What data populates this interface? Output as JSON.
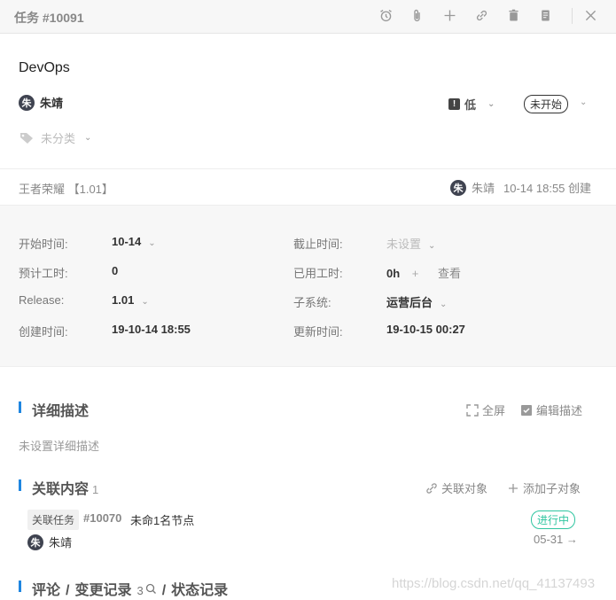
{
  "header": {
    "title": "任务 #10091",
    "icons": [
      "alarm-icon",
      "attachment-icon",
      "add-icon",
      "link-icon",
      "delete-icon",
      "copy-icon",
      "close-icon"
    ]
  },
  "task": {
    "name": "DevOps",
    "assignee": {
      "avatar": "朱",
      "name": "朱靖"
    },
    "priority": {
      "flag": "!",
      "label": "低"
    },
    "status": "未开始",
    "category": "未分类"
  },
  "meta": {
    "project": "王者荣耀 【1.01】",
    "creator_avatar": "朱",
    "creator_name": "朱靖",
    "created_text": "10-14 18:55 创建"
  },
  "props": {
    "start_label": "开始时间:",
    "start_value": "10-14",
    "due_label": "截止时间:",
    "due_value": "未设置",
    "estimate_label": "预计工时:",
    "estimate_value": "0",
    "spent_label": "已用工时:",
    "spent_value": "0h",
    "spent_add": "+",
    "spent_view": "查看",
    "release_label": "Release:",
    "release_value": "1.01",
    "subsystem_label": "子系统:",
    "subsystem_value": "运营后台",
    "created_label": "创建时间:",
    "created_value": "19-10-14 18:55",
    "updated_label": "更新时间:",
    "updated_value": "19-10-15 00:27"
  },
  "description": {
    "title": "详细描述",
    "fullscreen": "全屏",
    "edit": "编辑描述",
    "empty": "未设置详细描述"
  },
  "related": {
    "title": "关联内容",
    "count": "1",
    "link_action": "关联对象",
    "add_child": "添加子对象",
    "item": {
      "tag": "关联任务",
      "id": "#10070",
      "name": "未命1名节点",
      "avatar": "朱",
      "assignee": "朱靖",
      "status": "进行中",
      "date": "05-31 →"
    }
  },
  "tabs": {
    "comment": "评论",
    "sep1": "/",
    "history": "变更记录",
    "history_count": "3",
    "sep2": "/",
    "status_log": "状态记录"
  },
  "watermark": "https://blog.csdn.net/qq_41137493",
  "colors": {
    "accent": "#1f86e0",
    "in_progress": "#2fc5a0",
    "avatar_bg": "#3f4350"
  }
}
